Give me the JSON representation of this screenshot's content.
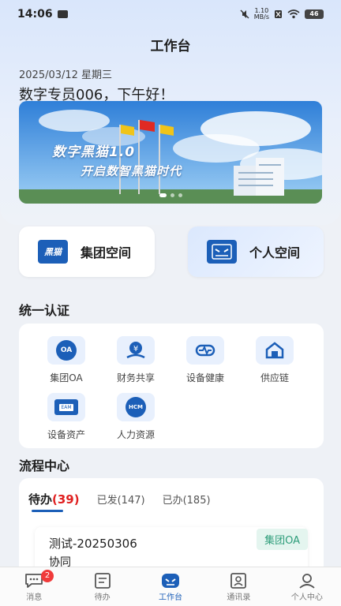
{
  "status_bar": {
    "time": "14:06",
    "net_speed_value": "1.10",
    "net_speed_unit": "MB/s",
    "battery": "46"
  },
  "header": {
    "title": "工作台"
  },
  "greeting": {
    "date": "2025/03/12 星期三",
    "text": "数字专员006，下午好！"
  },
  "banner": {
    "title": "数字黑猫1.0",
    "subtitle": "开启数智黑猫时代",
    "slide_count": 3,
    "active_index": 0
  },
  "spaces": {
    "group_label": "集团空间",
    "group_logo_text": "黑猫",
    "personal_label": "个人空间"
  },
  "auth": {
    "title": "统一认证",
    "items": [
      {
        "label": "集团OA",
        "icon": "oa-icon",
        "badge": "OA"
      },
      {
        "label": "财务共享",
        "icon": "finance-icon",
        "badge": ""
      },
      {
        "label": "设备健康",
        "icon": "device-health-icon",
        "badge": ""
      },
      {
        "label": "供应链",
        "icon": "supply-chain-icon",
        "badge": ""
      },
      {
        "label": "设备资产",
        "icon": "asset-icon",
        "badge": "EAM"
      },
      {
        "label": "人力资源",
        "icon": "hr-icon",
        "badge": "HCM"
      }
    ]
  },
  "flow": {
    "title": "流程中心",
    "tabs": [
      {
        "label": "待办",
        "count": "(39)"
      },
      {
        "label": "已发(147)"
      },
      {
        "label": "已办(185)"
      }
    ],
    "card": {
      "name": "测试-20250306",
      "type": "协同",
      "tag": "集团OA"
    }
  },
  "nav": {
    "items": [
      {
        "label": "消息",
        "badge": "2",
        "icon": "message-icon"
      },
      {
        "label": "待办",
        "icon": "todo-icon"
      },
      {
        "label": "工作台",
        "icon": "workbench-icon"
      },
      {
        "label": "通讯录",
        "icon": "contacts-icon"
      },
      {
        "label": "个人中心",
        "icon": "profile-icon"
      }
    ],
    "active_index": 2
  },
  "colors": {
    "accent": "#1c5fb8",
    "badge_red": "#f03b3b",
    "tag_green": "#2e9d7a"
  }
}
